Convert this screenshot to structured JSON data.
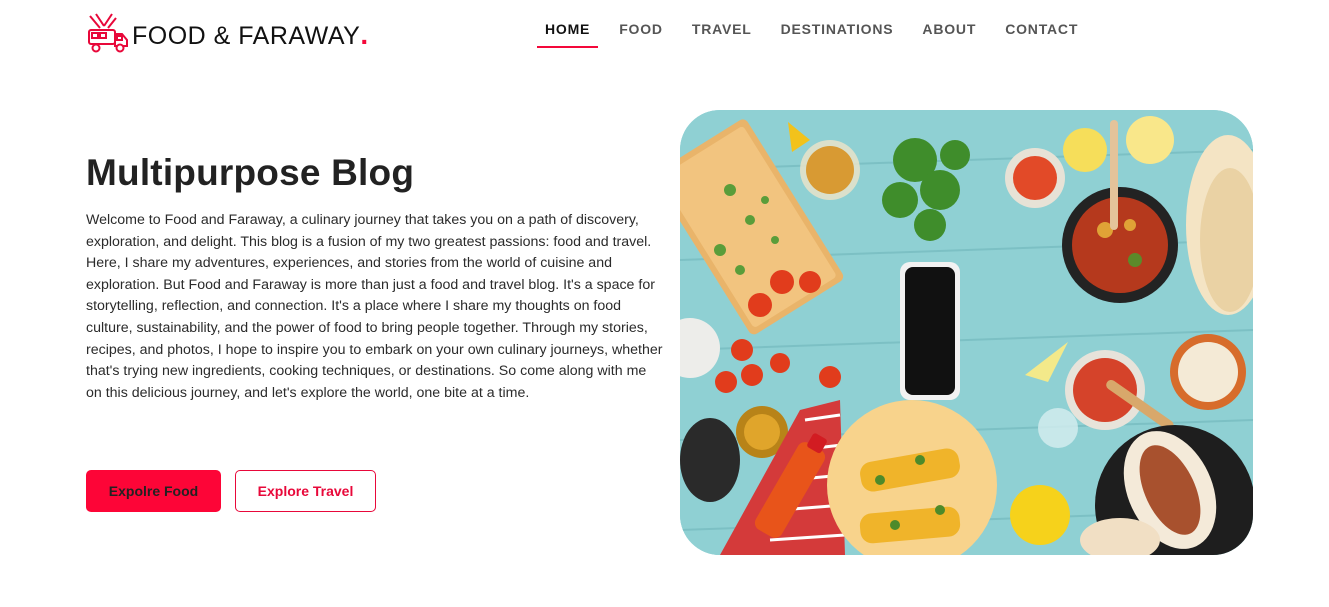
{
  "brand": {
    "name": "FOOD & FARAWAY",
    "dot": ".",
    "icon": "food-truck-icon",
    "accent_color": "#f4083a"
  },
  "nav": {
    "items": [
      {
        "label": "HOME",
        "active": true
      },
      {
        "label": "FOOD",
        "active": false
      },
      {
        "label": "TRAVEL",
        "active": false
      },
      {
        "label": "DESTINATIONS",
        "active": false
      },
      {
        "label": "ABOUT",
        "active": false
      },
      {
        "label": "CONTACT",
        "active": false
      }
    ]
  },
  "hero": {
    "title": "Multipurpose Blog",
    "body": "Welcome to Food and Faraway, a culinary journey that takes you on a path of discovery, exploration, and delight. This blog is a fusion of my two greatest passions: food and travel. Here, I share my adventures, experiences, and stories from the world of cuisine and exploration. But Food and Faraway is more than just a food and travel blog. It's a space for storytelling, reflection, and connection. It's a place where I share my thoughts on food culture, sustainability, and the power of food to bring people together. Through my stories, recipes, and photos, I hope to inspire you to embark on your own culinary journeys, whether that's trying new ingredients, cooking techniques, or destinations. So come along with me on this delicious journey, and let's explore the world, one bite at a time.",
    "primary_button": "Expolre Food",
    "secondary_button": "Explore Travel",
    "image": "food-table-photo"
  }
}
